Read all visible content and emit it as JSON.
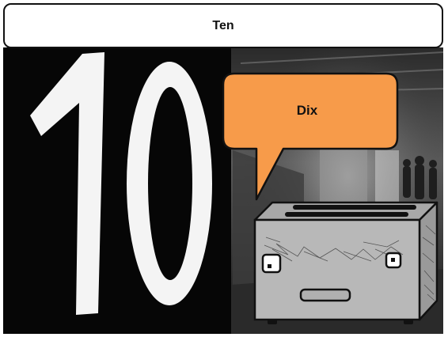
{
  "card": {
    "title": "Ten",
    "bubble_text": "Dix"
  },
  "icons": {
    "numeral_sign": "number-ten-sign-photo",
    "character": "toaster-character-icon",
    "speech_bubble": "speech-bubble-icon"
  },
  "colors": {
    "bubble_fill": "#f79b4a",
    "toaster_body": "#b8b8b8",
    "outline": "#111111",
    "background_dark": "#070707"
  }
}
